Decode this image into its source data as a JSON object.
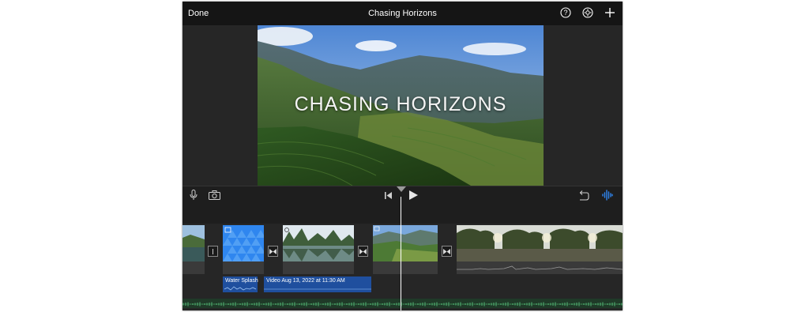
{
  "header": {
    "done_label": "Done",
    "project_title": "Chasing Horizons",
    "icons": [
      "help-icon",
      "settings-icon",
      "add-icon"
    ]
  },
  "viewer": {
    "title_overlay": "CHASING HORIZONS"
  },
  "controls": {
    "icons": [
      "microphone-icon",
      "camera-icon",
      "skip-to-start-icon",
      "play-icon",
      "undo-icon",
      "audio-waveform-icon"
    ]
  },
  "timeline": {
    "audio_clips": [
      {
        "label": "Water Splash"
      },
      {
        "label": "Video Aug 13, 2022 at 11:30 AM"
      }
    ]
  },
  "colors": {
    "accent_blue": "#2f86ef",
    "audio_blue": "#1f4f9e",
    "music_green": "#2f6b41",
    "background": "#1e1e1e"
  }
}
